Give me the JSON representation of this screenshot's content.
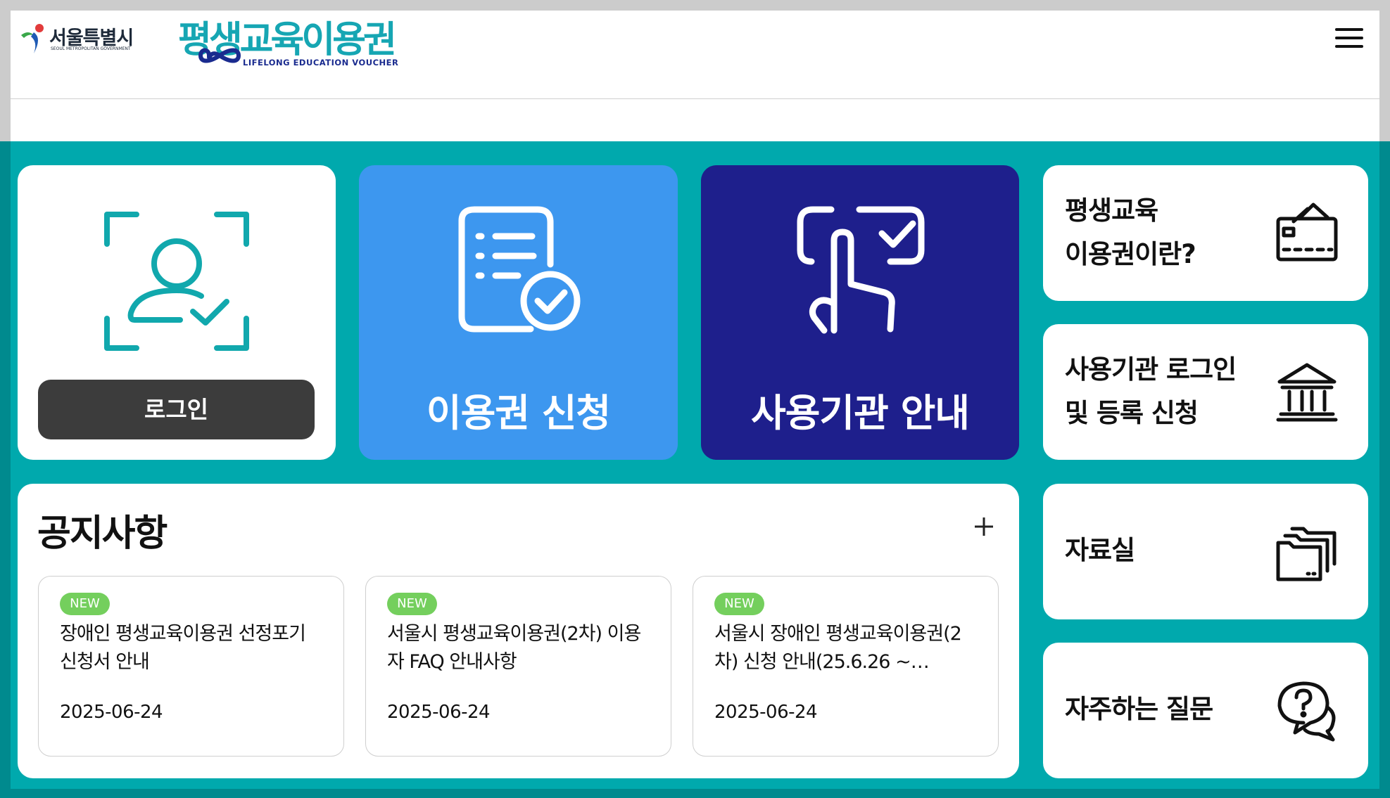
{
  "header": {
    "city_logo_text": "서울특별시",
    "city_logo_sub": "SEOUL METROPOLITAN GOVERNMENT",
    "brand_title": "평생교육이용권",
    "brand_sub": "LIFELONG EDUCATION VOUCHER"
  },
  "tiles": {
    "login_button": "로그인",
    "apply_label": "이용권 신청",
    "institution_label": "사용기관 안내"
  },
  "side_menu": [
    {
      "line1": "평생교육",
      "line2": "이용권이란?",
      "icon": "card-icon"
    },
    {
      "line1": "사용기관 로그인",
      "line2": "및 등록 신청",
      "icon": "institution-building-icon"
    },
    {
      "line1": "자료실",
      "line2": "",
      "icon": "folder-icon"
    },
    {
      "line1": "자주하는 질문",
      "line2": "",
      "icon": "question-chat-icon"
    }
  ],
  "notice": {
    "title": "공지사항",
    "more_icon": "plus-icon",
    "items": [
      {
        "badge": "NEW",
        "title": "장애인 평생교육이용권 선정포기 신청서 안내",
        "date": "2025-06-24"
      },
      {
        "badge": "NEW",
        "title": "서울시 평생교육이용권(2차) 이용자 FAQ 안내사항",
        "date": "2025-06-24"
      },
      {
        "badge": "NEW",
        "title": "서울시 장애인 평생교육이용권(2차) 신청 안내(25.6.26 ~…",
        "date": "2025-06-24"
      }
    ]
  },
  "colors": {
    "teal": "#00a9ad",
    "teal_dark": "#008a8e",
    "apply_blue": "#3d97ef",
    "navy": "#1e1f8c",
    "badge_green": "#74cf5d"
  }
}
